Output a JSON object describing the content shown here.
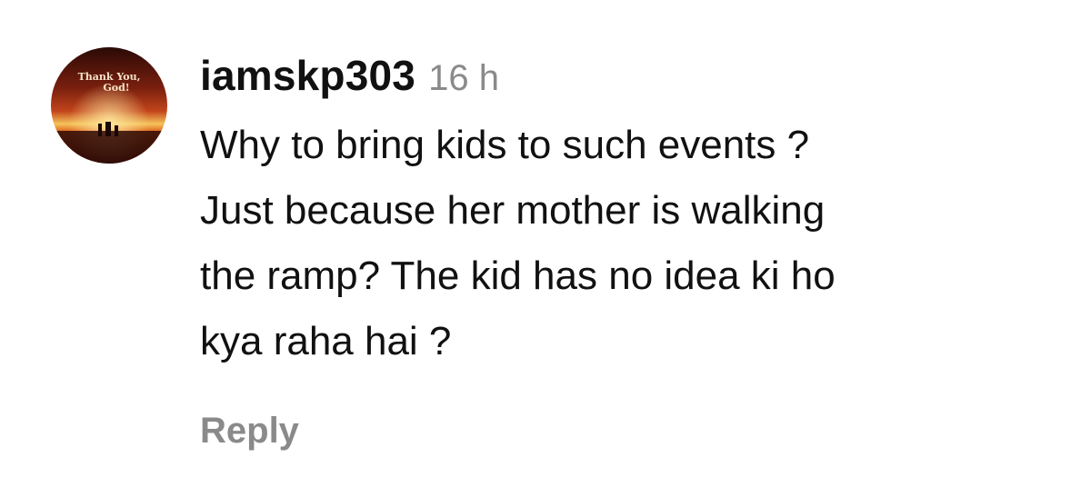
{
  "comment": {
    "avatar": {
      "overlay_text_line1": "Thank You,",
      "overlay_text_line2": "God!",
      "colors": {
        "sky_top": "#2a0a06",
        "sky_mid": "#c2451c",
        "horizon": "#f6c35a",
        "ground": "#3a0f08"
      }
    },
    "username": "iamskp303",
    "timestamp": "16 h",
    "text_lines": [
      "Why to bring kids to such events ?",
      "Just because her mother is walking",
      "the ramp? The kid has no idea ki ho",
      "kya raha hai ?"
    ],
    "reply_label": "Reply"
  },
  "colors": {
    "text": "#111111",
    "muted": "#8a8a8a",
    "background": "#ffffff"
  }
}
